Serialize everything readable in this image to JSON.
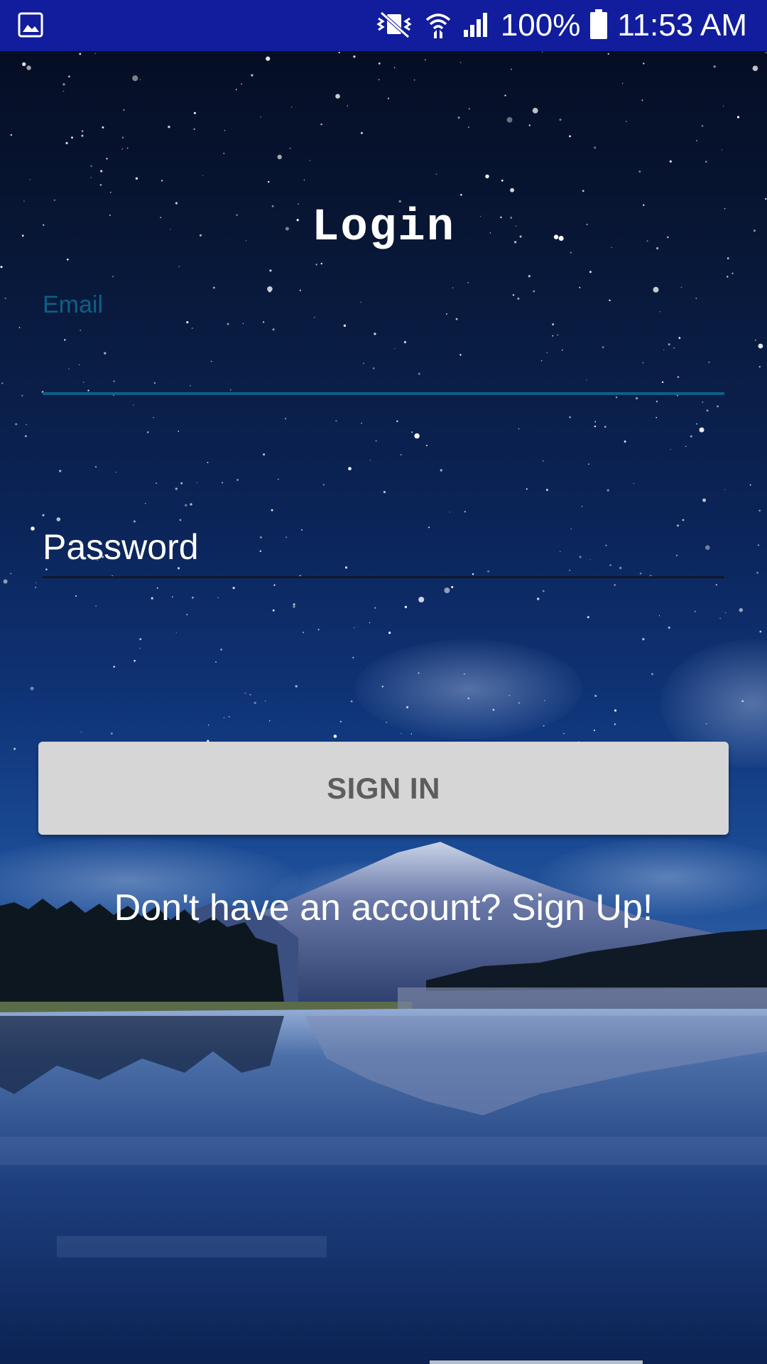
{
  "status_bar": {
    "battery_percent": "100%",
    "time": "11:53 AM",
    "icons": [
      "image-notification-icon",
      "vibrate-icon",
      "wifi-icon",
      "signal-icon",
      "battery-icon"
    ]
  },
  "login": {
    "title": "Login",
    "email": {
      "label": "Email",
      "value": ""
    },
    "password": {
      "placeholder": "Password",
      "value": ""
    },
    "sign_in_label": "SIGN IN",
    "signup_text": "Don't have an account? Sign Up!"
  },
  "colors": {
    "status_bar": "#111d9c",
    "accent": "#0f5f86",
    "button_bg": "#d6d6d6",
    "button_text": "#5d5d5d"
  }
}
